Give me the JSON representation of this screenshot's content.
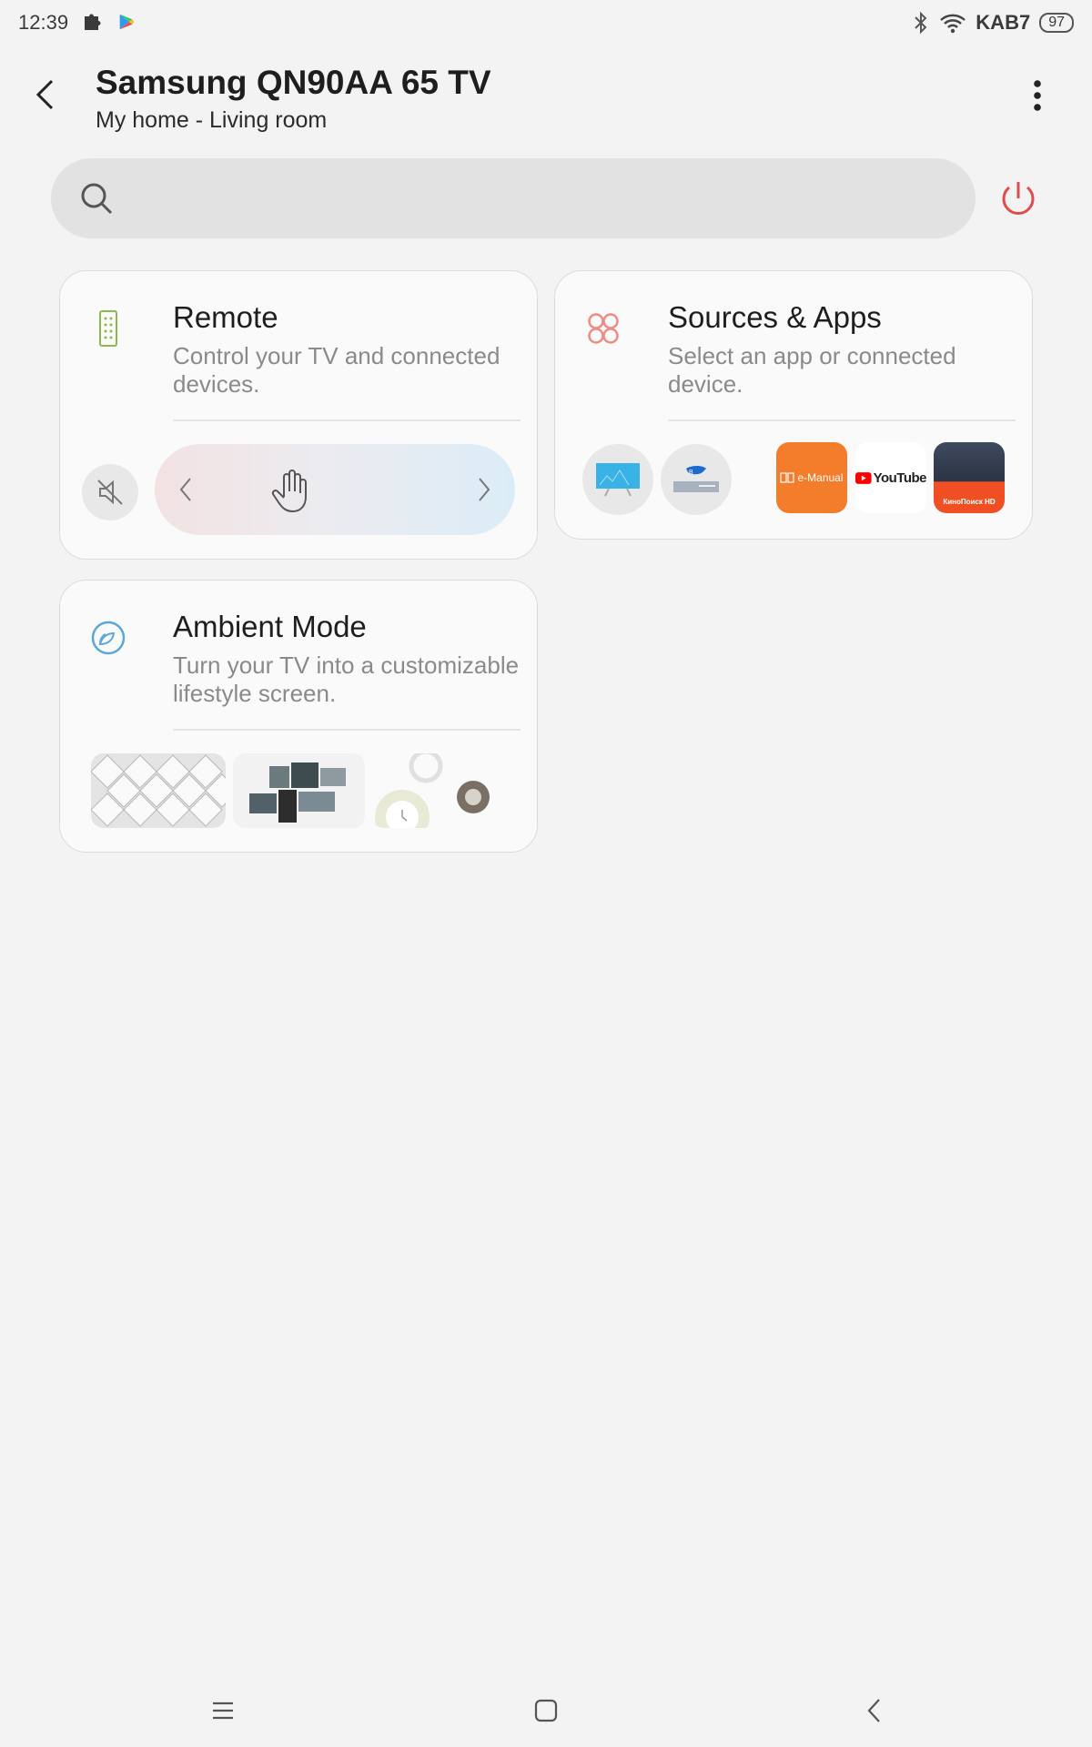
{
  "status_bar": {
    "time": "12:39",
    "network": "KAB7",
    "battery": "97",
    "icons": [
      "puzzle-icon",
      "play-store-icon",
      "bluetooth-icon",
      "wifi-icon",
      "battery-icon"
    ]
  },
  "header": {
    "title": "Samsung QN90AA 65 TV",
    "subtitle": "My home - Living room"
  },
  "search": {
    "placeholder": ""
  },
  "cards": {
    "remote": {
      "title": "Remote",
      "description": "Control your TV and connected devices."
    },
    "sources": {
      "title": "Sources & Apps",
      "description": "Select an app or connected device.",
      "apps": [
        "e-Manual",
        "YouTube",
        "КиноПоиск HD"
      ]
    },
    "ambient": {
      "title": "Ambient Mode",
      "description": "Turn your TV into a customizable lifestyle screen."
    }
  },
  "colors": {
    "power": "#e04b4b",
    "remote_icon": "#8dbb4a",
    "sources_icon": "#f08a85",
    "ambient_icon": "#5aa8d8",
    "background": "#f3f3f3"
  }
}
